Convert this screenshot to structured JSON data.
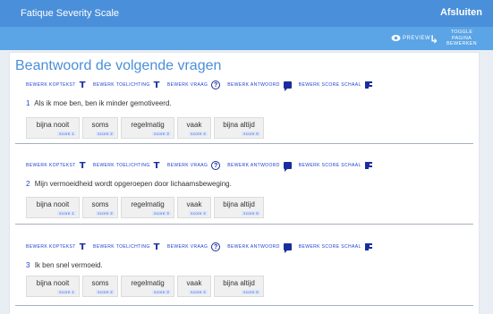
{
  "header": {
    "title": "Fatique Severity Scale",
    "close_label": "Afsluiten"
  },
  "subbar": {
    "preview_label": "PREVIEW",
    "toggle_label": "TOGGLE PAGINA BEWERKEN"
  },
  "main": {
    "heading": "Beantwoord de volgende vragen"
  },
  "toolbar": {
    "edit_header": "BEWERK KOPTEKST",
    "edit_explanation": "BEWERK TOELICHTING",
    "edit_question": "BEWERK VRAAG",
    "edit_answer": "BEWERK ANTWOORD",
    "edit_scale": "BEWERK SCORE SCHAAL"
  },
  "questions": [
    {
      "number": "1",
      "text": "Als ik moe ben, ben ik minder gemotiveerd."
    },
    {
      "number": "2",
      "text": "Mijn vermoeidheid wordt opgeroepen door lichaamsbeweging."
    },
    {
      "number": "3",
      "text": "Ik ben snel vermoeid."
    }
  ],
  "options": [
    {
      "label": "bijna nooit",
      "score": "score 1"
    },
    {
      "label": "soms",
      "score": "score 2"
    },
    {
      "label": "regelmatig",
      "score": "score 3"
    },
    {
      "label": "vaak",
      "score": "score 4"
    },
    {
      "label": "bijna altijd",
      "score": "score 5"
    }
  ],
  "colors": {
    "header_bg": "#4a8fd9",
    "subbar_bg": "#5ba4e6",
    "accent": "#1d3fd1",
    "page_bg": "#e9eef4"
  }
}
